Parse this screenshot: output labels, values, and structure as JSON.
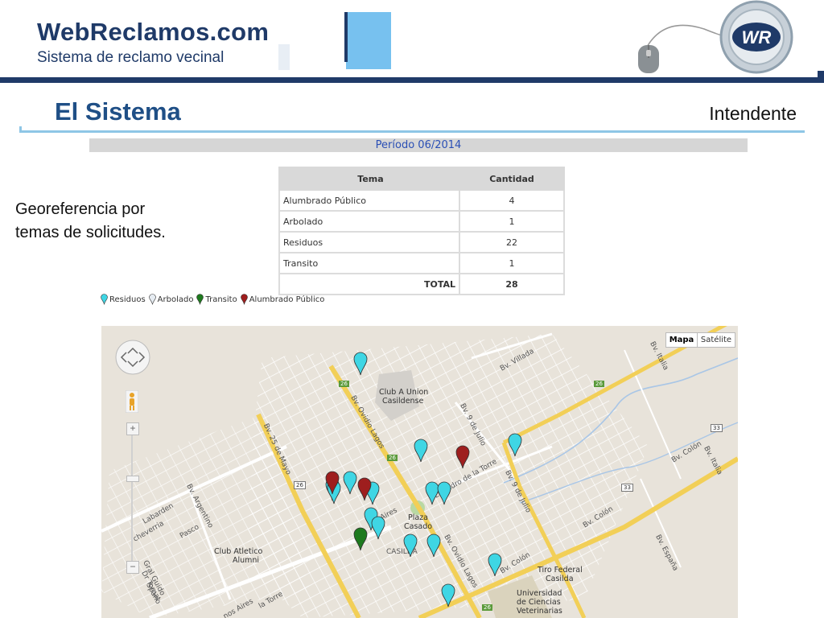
{
  "header": {
    "logo_text": "WebReclamos",
    "logo_domain": ".com",
    "tagline": "Sistema de reclamo vecinal",
    "badge": "WR"
  },
  "slide": {
    "title": "El Sistema",
    "role": "Intendente",
    "description_line1": "Georeferencia por",
    "description_line2": "temas de solicitudes."
  },
  "report": {
    "period": "Período 06/2014",
    "table": {
      "headers": [
        "Tema",
        "Cantidad"
      ],
      "rows": [
        {
          "tema": "Alumbrado Público",
          "cantidad": "4"
        },
        {
          "tema": "Arbolado",
          "cantidad": "1"
        },
        {
          "tema": "Residuos",
          "cantidad": "22"
        },
        {
          "tema": "Transito",
          "cantidad": "1"
        }
      ],
      "total_label": "TOTAL",
      "total_value": "28"
    }
  },
  "legend": [
    {
      "label": "Residuos",
      "color": "#3fd6e4"
    },
    {
      "label": "Arbolado",
      "color": "#e6ecf2"
    },
    {
      "label": "Transito",
      "color": "#1e7a1e"
    },
    {
      "label": "Alumbrado Público",
      "color": "#9e1e1e"
    }
  ],
  "map": {
    "type_buttons": [
      "Mapa",
      "Satélite"
    ],
    "labels": {
      "club_union": "Club A Union",
      "club_union2": "Casildense",
      "bv_villada": "Bv. Villada",
      "bv_italia": "Bv. Italia",
      "bv_9julio": "Bv. 9 de Julio",
      "bv_9julio_b": "Bv. 9 de Julio",
      "bv_25mayo": "Bv. 25 de Mayo",
      "bv_ovidio": "Bv. Ovidio Lagos",
      "bv_ovidio_b": "Bv. Ovidio Lagos",
      "bv_colon": "Bv. Colón",
      "bv_colon_b": "Bv. Colón",
      "bv_colon_c": "Bv. Colón",
      "bv_argentino": "Bv. Argentino",
      "bv_espana": "Bv. España",
      "bv_italia2": "Bv. Italia",
      "lisandro": "Lisandro de la Torre",
      "aires": "Aires",
      "plaza": "Plaza",
      "plaza2": "Casado",
      "casilda": "CASILDA",
      "club_alumni": "Club Atletico",
      "club_alumni2": "Alumni",
      "tiro_federal": "Tiro Federal",
      "tiro_federal2": "Casilda",
      "universidad": "Universidad",
      "universidad2": "de Ciencias",
      "universidad3": "Veterinarias",
      "labarden": "Labarden",
      "echeverria": "cheverria",
      "pasco": "Pasco",
      "gral_guido": "Gral Guido",
      "spano": "Spano",
      "drtomat": "Dr Tomat",
      "buenos_aires": "nos Aires",
      "la_torre": "la Torre",
      "route_26": "26",
      "route_33": "33"
    }
  }
}
